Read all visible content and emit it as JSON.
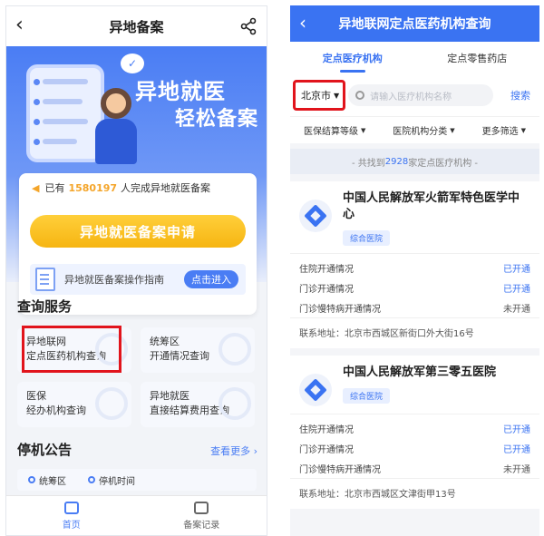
{
  "left": {
    "header": {
      "title": "异地备案"
    },
    "banner": {
      "line1": "异地就医",
      "line2": "轻松备案",
      "bubble": "✓"
    },
    "notice": {
      "prefix": "已有",
      "count": "1580197",
      "suffix": "人完成异地就医备案"
    },
    "apply_button": "异地就医备案申请",
    "guide": {
      "text": "异地就医备案操作指南",
      "button": "点击进入"
    },
    "query_section": {
      "title": "查询服务",
      "items": [
        {
          "line1": "异地联网",
          "line2": "定点医药机构查询"
        },
        {
          "line1": "统筹区",
          "line2": "开通情况查询"
        },
        {
          "line1": "医保",
          "line2": "经办机构查询"
        },
        {
          "line1": "异地就医",
          "line2": "直接结算费用查询"
        }
      ]
    },
    "announce": {
      "title": "停机公告",
      "more": "查看更多",
      "col1": "统筹区",
      "col2": "停机时间"
    },
    "tabbar": [
      {
        "label": "首页"
      },
      {
        "label": "备案记录"
      }
    ]
  },
  "right": {
    "header": {
      "title": "异地联网定点医药机构查询"
    },
    "tabs": [
      {
        "label": "定点医疗机构"
      },
      {
        "label": "定点零售药店"
      }
    ],
    "search": {
      "city": "北京市",
      "placeholder": "请输入医疗机构名称",
      "button": "搜索"
    },
    "filters": [
      {
        "label": "医保结算等级"
      },
      {
        "label": "医院机构分类"
      },
      {
        "label": "更多筛选"
      }
    ],
    "count": {
      "prefix": "- 共找到",
      "number": "2928",
      "suffix": "家定点医疗机构 -"
    },
    "institutions": [
      {
        "name": "中国人民解放军火箭军特色医学中心",
        "badge": "综合医院",
        "rows": [
          {
            "label": "住院开通情况",
            "value": "已开通"
          },
          {
            "label": "门诊开通情况",
            "value": "已开通"
          },
          {
            "label": "门诊慢特病开通情况",
            "value": "未开通"
          }
        ],
        "address": "联系地址：北京市西城区新街口外大街16号"
      },
      {
        "name": "中国人民解放军第三零五医院",
        "badge": "综合医院",
        "rows": [
          {
            "label": "住院开通情况",
            "value": "已开通"
          },
          {
            "label": "门诊开通情况",
            "value": "已开通"
          },
          {
            "label": "门诊慢特病开通情况",
            "value": "未开通"
          }
        ],
        "address": "联系地址：北京市西城区文津街甲13号"
      }
    ]
  },
  "colors": {
    "primary": "#3a73f2",
    "accent": "#f6b512",
    "highlight": "#e1141c"
  }
}
